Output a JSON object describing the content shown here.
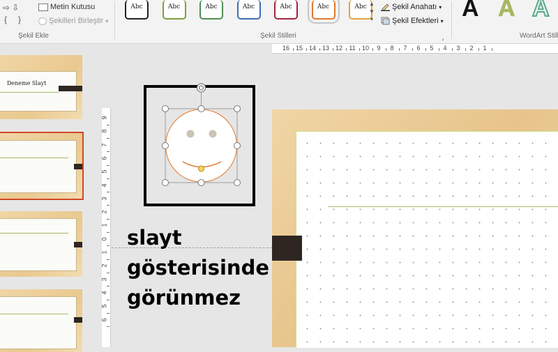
{
  "ribbon": {
    "insert_shapes": {
      "text_box_label": "Metin Kutusu",
      "merge_shapes_label": "Şekilleri Birleştir",
      "group_label": "Şekil Ekle",
      "shape_glyphs": [
        "⇨",
        "⇩",
        "{",
        "}"
      ]
    },
    "shape_styles": {
      "group_label": "Şekil Stilleri",
      "swatch_text": "Abc",
      "swatches": [
        {
          "border": "#222222"
        },
        {
          "border": "#7ea13f"
        },
        {
          "border": "#4f8f52"
        },
        {
          "border": "#3e6db5"
        },
        {
          "border": "#a3243b"
        },
        {
          "border": "#e07a2e",
          "selected": true
        },
        {
          "border": "#e3a23b"
        }
      ],
      "outline_label": "Şekil Anahatı",
      "effects_label": "Şekil Efektleri"
    },
    "wordart": {
      "group_label": "WordArt Still",
      "samples": [
        {
          "glyph": "A",
          "color": "#111111"
        },
        {
          "glyph": "A",
          "color": "#a6b85d"
        },
        {
          "glyph": "A",
          "color": "#5da88a"
        }
      ]
    }
  },
  "thumbnails": {
    "first_title": "Deneme Slayt"
  },
  "ruler": {
    "horizontal_labels": [
      "16",
      "15",
      "14",
      "13",
      "12",
      "11",
      "10",
      "9",
      "8",
      "7",
      "6",
      "5",
      "4",
      "3",
      "2",
      "1"
    ],
    "vertical_labels": [
      "9",
      "8",
      "7",
      "6",
      "5",
      "4",
      "3",
      "2",
      "1",
      "0",
      "1",
      "2",
      "3",
      "4",
      "5",
      "6"
    ]
  },
  "note": {
    "lines": [
      "slayt",
      "gösterisinde",
      "görünmez"
    ]
  },
  "colors": {
    "selection_outline": "#d24726",
    "slide_frame": "#e9c98f",
    "accent_line": "#a9b96a",
    "smiley_stroke": "#e07a2e"
  }
}
